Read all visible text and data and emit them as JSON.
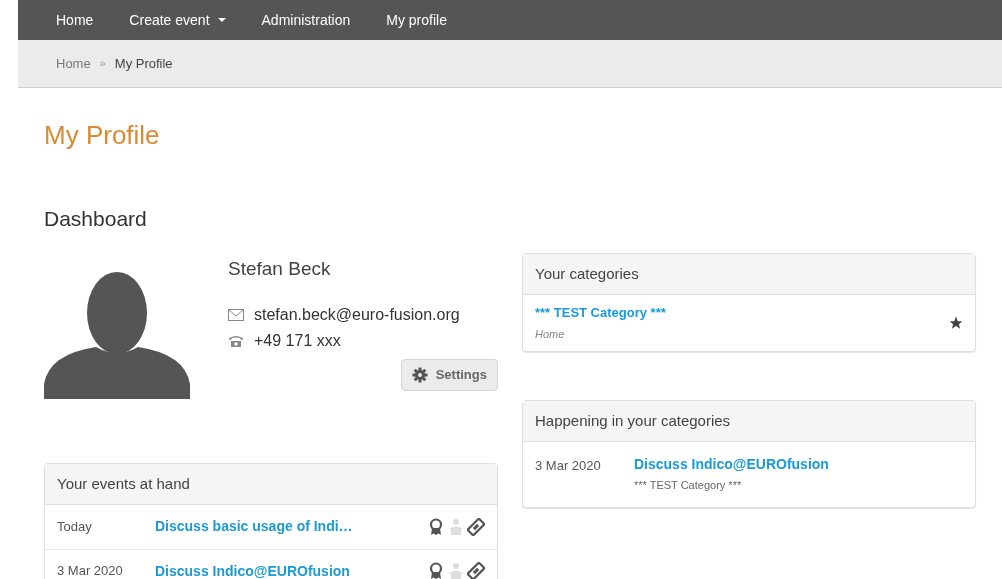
{
  "nav": [
    {
      "label": "Home",
      "dropdown": false
    },
    {
      "label": "Create event",
      "dropdown": true
    },
    {
      "label": "Administration",
      "dropdown": false
    },
    {
      "label": "My profile",
      "dropdown": false
    }
  ],
  "breadcrumb": {
    "items": [
      "Home",
      "My Profile"
    ],
    "separator": "»"
  },
  "page_title": "My Profile",
  "section_title": "Dashboard",
  "profile": {
    "name": "Stefan Beck",
    "email": "stefan.beck@euro-fusion.org",
    "phone": "+49 171 xxx",
    "settings_button": "Settings"
  },
  "events_panel": {
    "title": "Your events at hand",
    "rows": [
      {
        "date": "Today",
        "title": "Discuss basic usage of Indi…",
        "icons": [
          {
            "kind": "award",
            "enabled": true
          },
          {
            "kind": "person",
            "enabled": false
          },
          {
            "kind": "ticket",
            "enabled": true
          }
        ]
      },
      {
        "date": "3 Mar 2020",
        "title": "Discuss Indico@EUROfusion",
        "icons": [
          {
            "kind": "award",
            "enabled": true
          },
          {
            "kind": "person",
            "enabled": false
          },
          {
            "kind": "ticket",
            "enabled": true
          }
        ]
      }
    ]
  },
  "categories_panel": {
    "title": "Your categories",
    "items": [
      {
        "name": "*** TEST Category ***",
        "path": "Home",
        "favorite": true
      }
    ]
  },
  "happening_panel": {
    "title": "Happening in your categories",
    "rows": [
      {
        "date": "3 Mar 2020",
        "title": "Discuss Indico@EUROfusion",
        "category": "*** TEST Category ***"
      }
    ]
  }
}
